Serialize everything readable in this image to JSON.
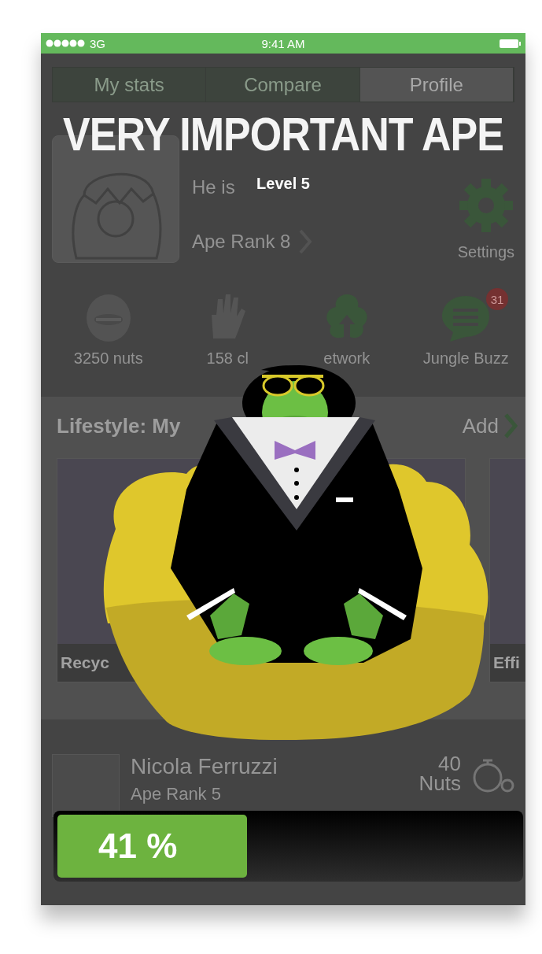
{
  "status_bar": {
    "network": "3G",
    "time": "9:41 AM"
  },
  "tabs": [
    {
      "label": "My stats",
      "selected": false
    },
    {
      "label": "Compare",
      "selected": false
    },
    {
      "label": "Profile",
      "selected": true
    }
  ],
  "profile": {
    "status": "He is",
    "rank": "Ape Rank 8",
    "settings_label": "Settings"
  },
  "stats": [
    {
      "label": "3250 nuts",
      "kind": "face"
    },
    {
      "label": "158 cl",
      "kind": "hand"
    },
    {
      "label": "etwork",
      "kind": "tree"
    },
    {
      "label": "Jungle Buzz",
      "kind": "chat",
      "badge": "31"
    }
  ],
  "lifestyle": {
    "title": "Lifestyle: My",
    "action": "Add",
    "cards": [
      {
        "label": "Recyc"
      },
      {
        "label": "Effi"
      }
    ]
  },
  "leaderboard": [
    {
      "name": "Nicola Ferruzzi",
      "rank": "Ape Rank 5",
      "nuts": "40",
      "unit": "Nuts"
    }
  ],
  "achievement": {
    "title": "VERY IMPORTANT APE",
    "subtitle": "Level 5",
    "progress": {
      "level": 0.41,
      "label": "41 %"
    }
  }
}
